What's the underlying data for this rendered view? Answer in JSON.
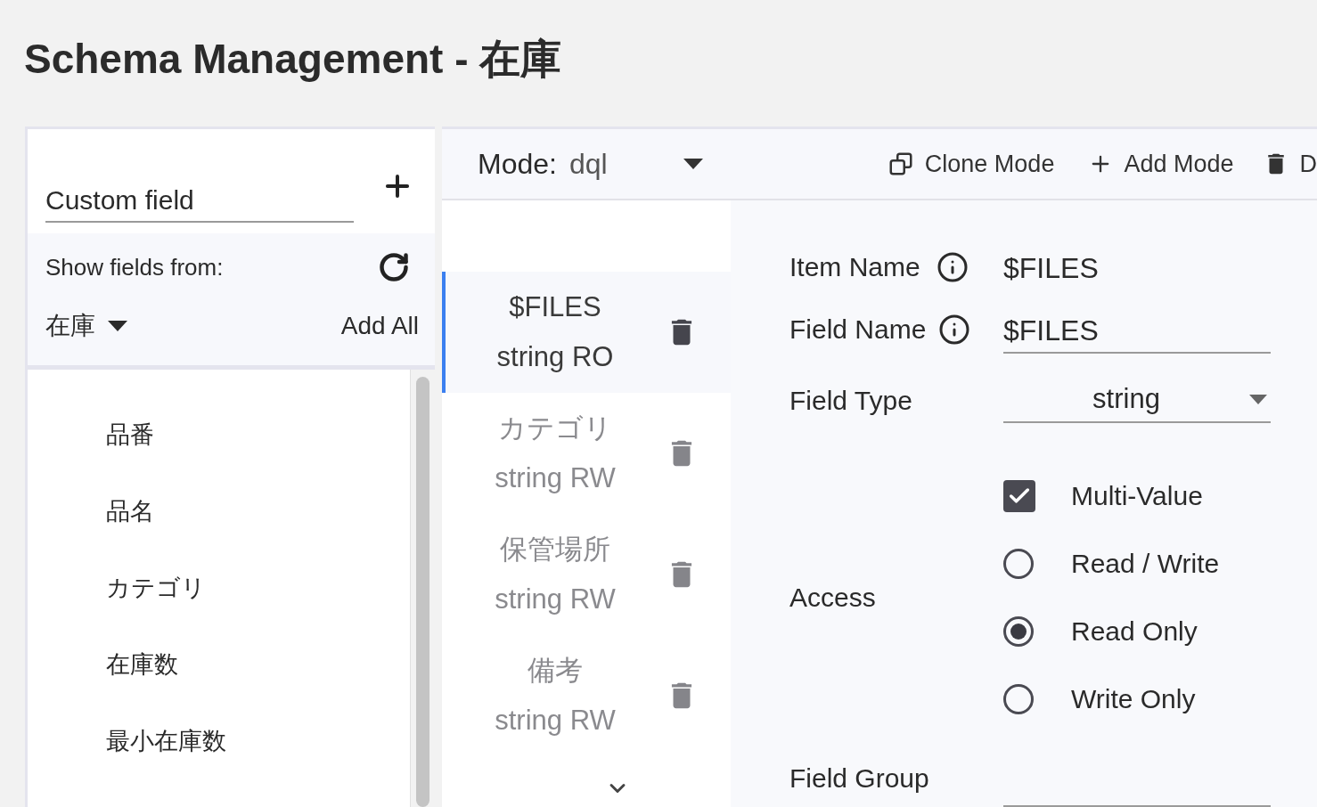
{
  "page": {
    "title": "Schema Management - 在庫"
  },
  "sidebar": {
    "custom_field": {
      "value": "Custom field"
    },
    "show_fields_label": "Show fields from:",
    "source": "在庫",
    "add_all": "Add All",
    "fields": [
      {
        "label": "品番"
      },
      {
        "label": "品名"
      },
      {
        "label": "カテゴリ"
      },
      {
        "label": "在庫数"
      },
      {
        "label": "最小在庫数"
      }
    ]
  },
  "mode_bar": {
    "label": "Mode:",
    "value": "dql",
    "actions": [
      {
        "kind": "clone",
        "label": "Clone Mode"
      },
      {
        "kind": "add",
        "label": "Add Mode"
      },
      {
        "kind": "delete",
        "label": "D"
      }
    ]
  },
  "field_list": {
    "items": [
      {
        "name": "$FILES",
        "type": "string RO",
        "selected": true
      },
      {
        "name": "カテゴリ",
        "type": "string RW",
        "selected": false
      },
      {
        "name": "保管場所",
        "type": "string RW",
        "selected": false
      },
      {
        "name": "備考",
        "type": "string RW",
        "selected": false
      }
    ]
  },
  "details": {
    "item_name": {
      "label": "Item Name",
      "value": "$FILES"
    },
    "field_name": {
      "label": "Field Name",
      "value": "$FILES"
    },
    "field_type": {
      "label": "Field Type",
      "value": "string"
    },
    "access": {
      "label": "Access",
      "options": [
        {
          "kind": "checkbox",
          "label": "Multi-Value",
          "checked": true
        },
        {
          "kind": "radio",
          "label": "Read / Write",
          "selected": false
        },
        {
          "kind": "radio",
          "label": "Read Only",
          "selected": true
        },
        {
          "kind": "radio",
          "label": "Write Only",
          "selected": false
        }
      ]
    },
    "field_group": {
      "label": "Field Group"
    }
  }
}
